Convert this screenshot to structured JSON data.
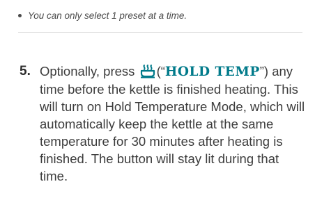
{
  "note": {
    "bullet_text": "You can only select 1 preset at a time."
  },
  "step": {
    "number": "5.",
    "text_before_icon": "Optionally, press",
    "open_paren_quote": "(“",
    "hold_label": "HOLD TEMP",
    "close_quote_paren": "”)",
    "text_after": "any time before the kettle is finished heating. This will turn on Hold Temperature Mode, which will automatically keep the kettle at the same temperature for 30 minutes after heating is finished. The button will stay lit during that time.",
    "icon": "hold-temp-icon"
  },
  "colors": {
    "accent": "#007a8a",
    "body_text": "#3c3c3c"
  }
}
